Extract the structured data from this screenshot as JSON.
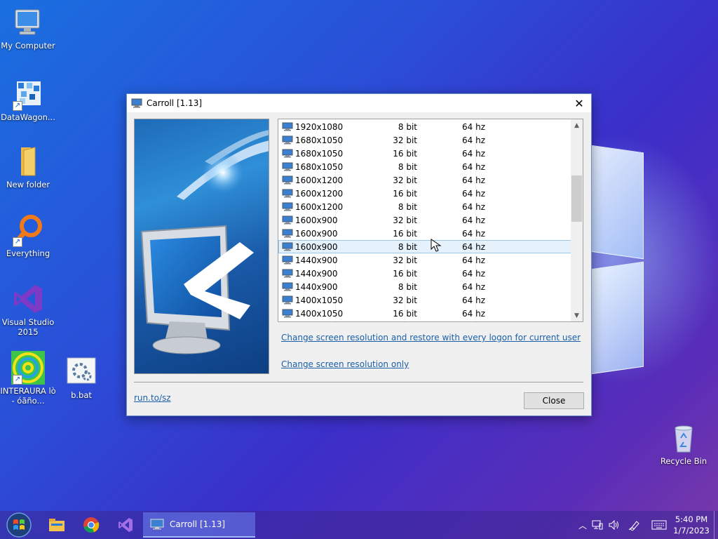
{
  "desktop": {
    "icons": [
      {
        "label": "My Computer"
      },
      {
        "label": "DataWagon..."
      },
      {
        "label": "New folder"
      },
      {
        "label": "Everything"
      },
      {
        "label": "Visual Studio 2015"
      },
      {
        "label": "INTERAURA lò - óãño..."
      },
      {
        "label": "b.bat"
      },
      {
        "label": "Recycle Bin"
      }
    ]
  },
  "dialog": {
    "title": "Carroll [1.13]",
    "list": [
      {
        "res": "1920x1080",
        "bit": "8 bit",
        "hz": "64 hz"
      },
      {
        "res": "1680x1050",
        "bit": "32 bit",
        "hz": "64 hz"
      },
      {
        "res": "1680x1050",
        "bit": "16 bit",
        "hz": "64 hz"
      },
      {
        "res": "1680x1050",
        "bit": "8 bit",
        "hz": "64 hz"
      },
      {
        "res": "1600x1200",
        "bit": "32 bit",
        "hz": "64 hz"
      },
      {
        "res": "1600x1200",
        "bit": "16 bit",
        "hz": "64 hz"
      },
      {
        "res": "1600x1200",
        "bit": "8 bit",
        "hz": "64 hz"
      },
      {
        "res": "1600x900",
        "bit": "32 bit",
        "hz": "64 hz"
      },
      {
        "res": "1600x900",
        "bit": "16 bit",
        "hz": "64 hz"
      },
      {
        "res": "1600x900",
        "bit": "8 bit",
        "hz": "64 hz",
        "selected": true
      },
      {
        "res": "1440x900",
        "bit": "32 bit",
        "hz": "64 hz"
      },
      {
        "res": "1440x900",
        "bit": "16 bit",
        "hz": "64 hz"
      },
      {
        "res": "1440x900",
        "bit": "8 bit",
        "hz": "64 hz"
      },
      {
        "res": "1400x1050",
        "bit": "32 bit",
        "hz": "64 hz"
      },
      {
        "res": "1400x1050",
        "bit": "16 bit",
        "hz": "64 hz"
      }
    ],
    "link_restore": "Change screen resolution and restore with every logon for current user",
    "link_only": "Change screen resolution only",
    "run_link": "run.to/sz",
    "close_label": "Close"
  },
  "taskbar": {
    "active_window": "Carroll [1.13]",
    "time": "5:40 PM",
    "date": "1/7/2023"
  },
  "colors": {
    "link": "#1a5fa8",
    "selection": "#e5f1fb"
  }
}
